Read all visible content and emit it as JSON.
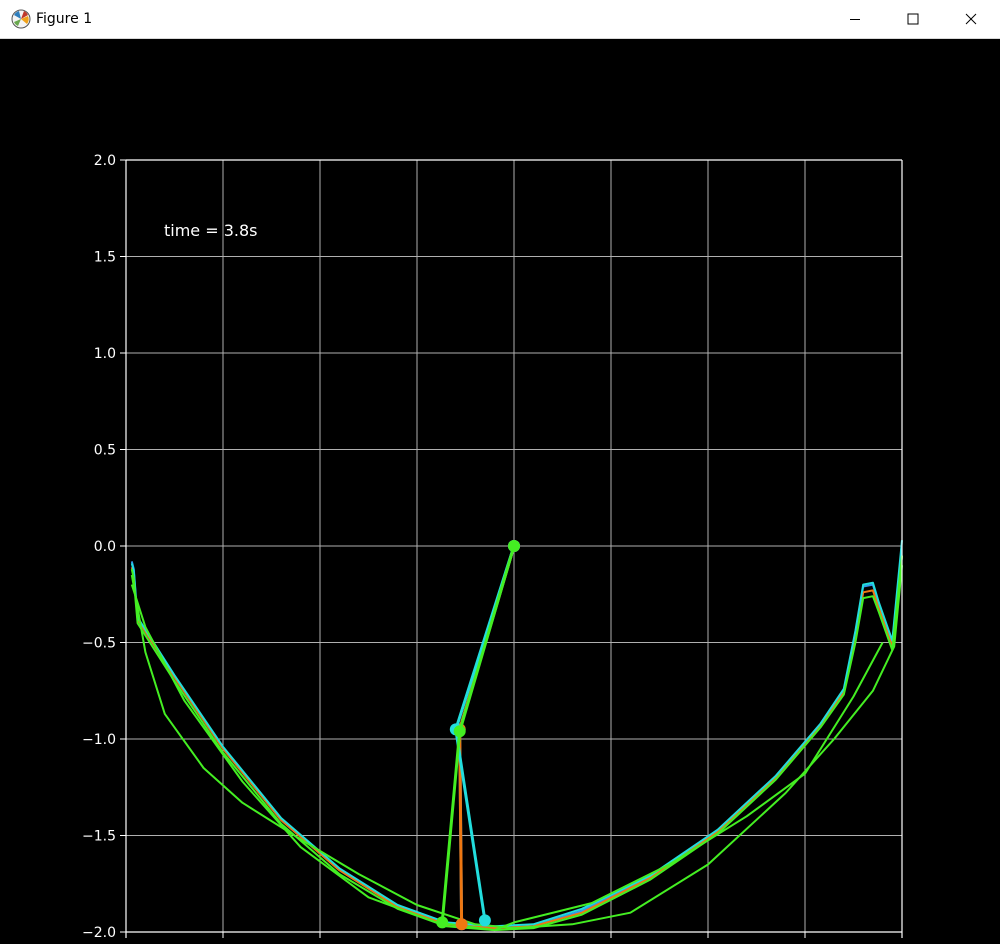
{
  "window": {
    "title": "Figure 1",
    "icon": "matplotlib-icon",
    "controls": [
      "minimize-icon",
      "maximize-icon",
      "close-icon"
    ]
  },
  "colors": {
    "background": "#000000",
    "grid": "#b0b0b0",
    "axes": "#ffffff",
    "text": "#ffffff",
    "green": "#44ee22",
    "cyan": "#22dddd",
    "orange": "#ee7711",
    "blue": "#3399ee"
  },
  "chart_data": {
    "type": "line",
    "title": "",
    "annotation": "time = 3.8s",
    "xlabel": "",
    "ylabel": "",
    "xlim": [
      -2.0,
      2.0
    ],
    "ylim": [
      -2.0,
      2.0
    ],
    "yticks": [
      2.0,
      1.5,
      1.0,
      0.5,
      0.0,
      -0.5,
      -1.0,
      -1.5,
      -2.0
    ],
    "ytick_labels": [
      "2.0",
      "1.5",
      "1.0",
      "0.5",
      "0.0",
      "−0.5",
      "−1.0",
      "−1.5",
      "−2.0"
    ],
    "xticks": [
      -2.0,
      -1.5,
      -1.0,
      -0.5,
      0.0,
      0.5,
      1.0,
      1.5,
      2.0
    ],
    "grid": true,
    "series": [
      {
        "color": "#3399ee",
        "trace": [
          [
            -1.97,
            -0.08
          ],
          [
            -1.96,
            -0.12
          ],
          [
            -1.95,
            -0.25
          ],
          [
            -1.94,
            -0.38
          ],
          [
            -1.75,
            -0.68
          ],
          [
            -1.5,
            -1.05
          ],
          [
            -1.2,
            -1.42
          ],
          [
            -0.9,
            -1.68
          ],
          [
            -0.6,
            -1.87
          ],
          [
            -0.35,
            -1.96
          ],
          [
            -0.1,
            -1.98
          ],
          [
            0.1,
            -1.97
          ],
          [
            0.35,
            -1.89
          ],
          [
            0.7,
            -1.72
          ],
          [
            1.05,
            -1.48
          ],
          [
            1.35,
            -1.2
          ],
          [
            1.58,
            -0.93
          ],
          [
            1.7,
            -0.75
          ],
          [
            1.76,
            -0.45
          ],
          [
            1.8,
            -0.21
          ],
          [
            1.85,
            -0.2
          ],
          [
            1.88,
            -0.3
          ],
          [
            1.95,
            -0.5
          ],
          [
            2.0,
            -0.05
          ]
        ],
        "pendulum": [
          [
            0.0,
            0.0
          ],
          [
            -0.28,
            -0.95
          ],
          [
            -0.27,
            -1.96
          ]
        ]
      },
      {
        "color": "#ee7711",
        "trace": [
          [
            -1.97,
            -0.11
          ],
          [
            -1.96,
            -0.15
          ],
          [
            -1.95,
            -0.27
          ],
          [
            -1.94,
            -0.38
          ],
          [
            -1.75,
            -0.68
          ],
          [
            -1.5,
            -1.05
          ],
          [
            -1.2,
            -1.42
          ],
          [
            -0.9,
            -1.68
          ],
          [
            -0.6,
            -1.87
          ],
          [
            -0.35,
            -1.96
          ],
          [
            -0.1,
            -1.98
          ],
          [
            0.1,
            -1.97
          ],
          [
            0.35,
            -1.9
          ],
          [
            0.7,
            -1.72
          ],
          [
            1.05,
            -1.48
          ],
          [
            1.35,
            -1.2
          ],
          [
            1.58,
            -0.93
          ],
          [
            1.7,
            -0.76
          ],
          [
            1.76,
            -0.48
          ],
          [
            1.8,
            -0.24
          ],
          [
            1.85,
            -0.23
          ],
          [
            1.88,
            -0.32
          ],
          [
            1.95,
            -0.52
          ],
          [
            2.0,
            -0.05
          ]
        ],
        "pendulum": [
          [
            0.0,
            0.0
          ],
          [
            -0.28,
            -0.95
          ],
          [
            -0.27,
            -1.96
          ]
        ]
      },
      {
        "color": "#22dddd",
        "trace": [
          [
            -1.97,
            -0.09
          ],
          [
            -1.96,
            -0.13
          ],
          [
            -1.95,
            -0.26
          ],
          [
            -1.94,
            -0.37
          ],
          [
            -1.75,
            -0.67
          ],
          [
            -1.5,
            -1.04
          ],
          [
            -1.2,
            -1.41
          ],
          [
            -0.9,
            -1.67
          ],
          [
            -0.6,
            -1.86
          ],
          [
            -0.35,
            -1.95
          ],
          [
            -0.1,
            -1.97
          ],
          [
            0.1,
            -1.96
          ],
          [
            0.35,
            -1.88
          ],
          [
            0.7,
            -1.71
          ],
          [
            1.05,
            -1.47
          ],
          [
            1.35,
            -1.19
          ],
          [
            1.58,
            -0.92
          ],
          [
            1.7,
            -0.74
          ],
          [
            1.76,
            -0.44
          ],
          [
            1.8,
            -0.2
          ],
          [
            1.85,
            -0.19
          ],
          [
            1.88,
            -0.29
          ],
          [
            1.95,
            -0.49
          ],
          [
            2.0,
            0.03
          ]
        ],
        "pendulum": [
          [
            0.0,
            0.0
          ],
          [
            -0.3,
            -0.95
          ],
          [
            -0.15,
            -1.94
          ]
        ]
      },
      {
        "color": "#44ee22",
        "trace": [
          [
            -1.97,
            -0.12
          ],
          [
            -1.96,
            -0.17
          ],
          [
            -1.95,
            -0.29
          ],
          [
            -1.94,
            -0.4
          ],
          [
            -1.75,
            -0.7
          ],
          [
            -1.5,
            -1.07
          ],
          [
            -1.2,
            -1.44
          ],
          [
            -0.9,
            -1.7
          ],
          [
            -0.6,
            -1.88
          ],
          [
            -0.35,
            -1.97
          ],
          [
            -0.1,
            -1.99
          ],
          [
            0.1,
            -1.98
          ],
          [
            0.35,
            -1.91
          ],
          [
            0.7,
            -1.73
          ],
          [
            1.05,
            -1.49
          ],
          [
            1.35,
            -1.21
          ],
          [
            1.58,
            -0.94
          ],
          [
            1.7,
            -0.77
          ],
          [
            1.76,
            -0.5
          ],
          [
            1.8,
            -0.27
          ],
          [
            1.85,
            -0.26
          ],
          [
            1.88,
            -0.34
          ],
          [
            1.95,
            -0.54
          ],
          [
            2.0,
            -0.05
          ]
        ],
        "pendulum": [
          [
            0.0,
            0.0
          ],
          [
            -0.28,
            -0.96
          ],
          [
            -0.37,
            -1.95
          ]
        ]
      },
      {
        "color": "#44ee22",
        "trace": [
          [
            -1.97,
            -0.15
          ],
          [
            -1.9,
            -0.55
          ],
          [
            -1.8,
            -0.87
          ],
          [
            -1.6,
            -1.15
          ],
          [
            -1.4,
            -1.33
          ],
          [
            -1.1,
            -1.52
          ],
          [
            -0.8,
            -1.7
          ],
          [
            -0.5,
            -1.86
          ],
          [
            -0.2,
            -1.96
          ],
          [
            0.0,
            -1.98
          ],
          [
            0.3,
            -1.96
          ],
          [
            0.6,
            -1.9
          ],
          [
            1.0,
            -1.65
          ],
          [
            1.4,
            -1.28
          ],
          [
            1.65,
            -1.0
          ],
          [
            1.85,
            -0.75
          ],
          [
            1.96,
            -0.52
          ],
          [
            2.0,
            -0.1
          ]
        ],
        "pendulum": []
      },
      {
        "color": "#44ee22",
        "trace": [
          [
            -1.97,
            -0.2
          ],
          [
            -1.9,
            -0.42
          ],
          [
            -1.7,
            -0.8
          ],
          [
            -1.4,
            -1.22
          ],
          [
            -1.1,
            -1.56
          ],
          [
            -0.75,
            -1.82
          ],
          [
            -0.4,
            -1.95
          ],
          [
            -0.1,
            -1.99
          ],
          [
            0.0,
            -1.95
          ],
          [
            0.4,
            -1.85
          ],
          [
            0.8,
            -1.65
          ],
          [
            1.2,
            -1.4
          ],
          [
            1.5,
            -1.18
          ],
          [
            1.75,
            -0.78
          ],
          [
            1.9,
            -0.5
          ]
        ],
        "pendulum": []
      }
    ]
  }
}
